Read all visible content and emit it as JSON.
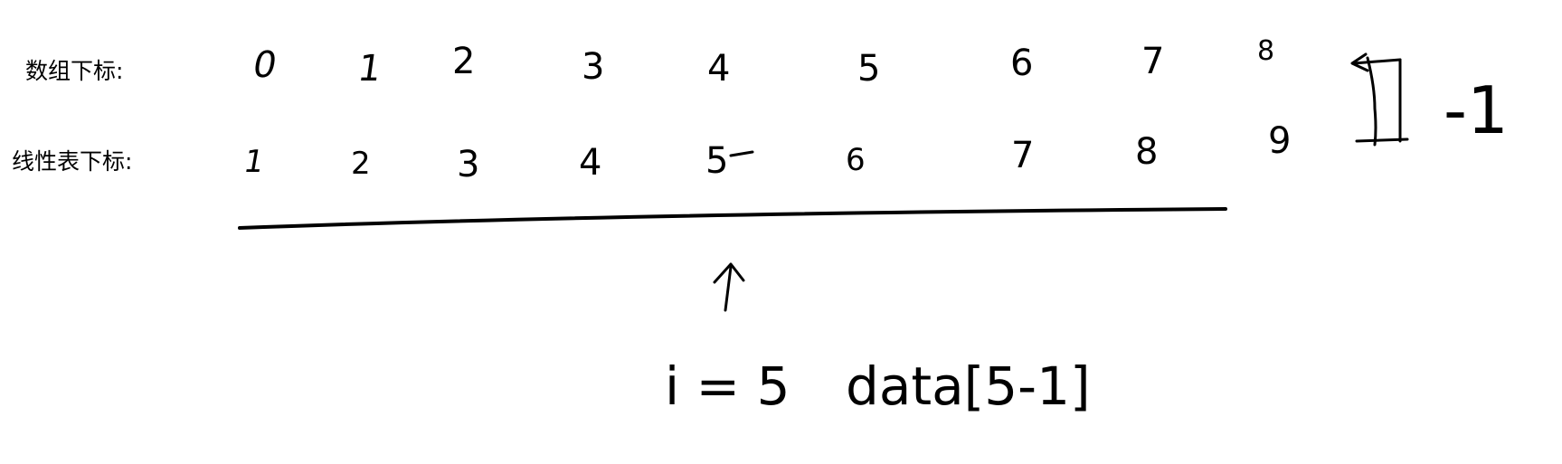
{
  "labels": {
    "array_index": "数组下标:",
    "linear_index": "线性表下标:"
  },
  "array_indices": [
    "0",
    "1",
    "2",
    "3",
    "4",
    "5",
    "6",
    "7",
    "8"
  ],
  "linear_indices": [
    "1",
    "2",
    "3",
    "4",
    "5",
    "6",
    "7",
    "8",
    "9"
  ],
  "annotation": {
    "minus_one": "-1",
    "equation": "i = 5",
    "expression": "data[5-1]"
  },
  "colors": {
    "ink": "#000000",
    "background": "#ffffff"
  }
}
